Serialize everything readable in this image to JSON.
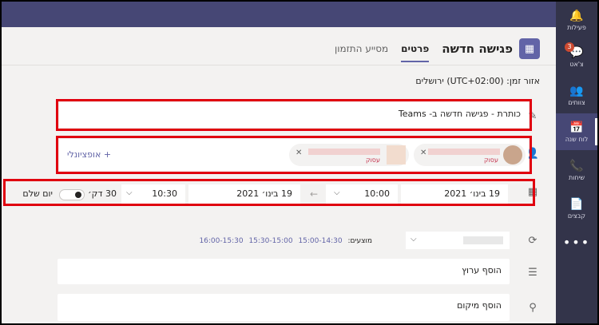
{
  "rail": {
    "items": [
      {
        "label": "פעילות",
        "icon": "bell-icon",
        "glyph": "🔔"
      },
      {
        "label": "צ'אט",
        "icon": "chat-icon",
        "glyph": "💬",
        "badge": "3"
      },
      {
        "label": "צוותים",
        "icon": "teams-icon",
        "glyph": "👥"
      },
      {
        "label": "לוח שנה",
        "icon": "calendar-icon",
        "glyph": "📅",
        "active": true
      },
      {
        "label": "שיחות",
        "icon": "phone-icon",
        "glyph": "📞"
      },
      {
        "label": "קבצים",
        "icon": "file-icon",
        "glyph": "📄"
      }
    ],
    "more": "•••"
  },
  "header": {
    "title": "פגישה חדשה",
    "tabs": [
      "פרטים",
      "מסייע התזמון"
    ],
    "icon": "calendar-edit-icon"
  },
  "timezone": "אזור זמן: (UTC+02:00) ירושלים",
  "title_field": {
    "value": "כותרת - פגישה חדשה ב- Teams",
    "icon": "pencil-icon"
  },
  "attendees": {
    "pills": [
      {
        "tag": "עסוק"
      },
      {
        "tag": "עסוק"
      }
    ],
    "optional": "+ אופציונלי",
    "icon": "add-person-icon"
  },
  "datetime": {
    "start_date": "19 בינו׳ 2021",
    "start_time": "10:00",
    "end_date": "19 בינו׳ 2021",
    "end_time": "10:30",
    "duration": "30 דק׳",
    "all_day": "יום שלם",
    "icon": "calendar-icon"
  },
  "suggestions": {
    "label": "מוצעים:",
    "options": [
      "15:00-14:30",
      "15:30-15:00",
      "16:00-15:30"
    ]
  },
  "recurrence": {
    "icon": "repeat-icon"
  },
  "channel": {
    "placeholder": "הוסף ערוץ",
    "icon": "channel-icon"
  },
  "location": {
    "placeholder": "הוסף מיקום",
    "icon": "location-icon"
  }
}
